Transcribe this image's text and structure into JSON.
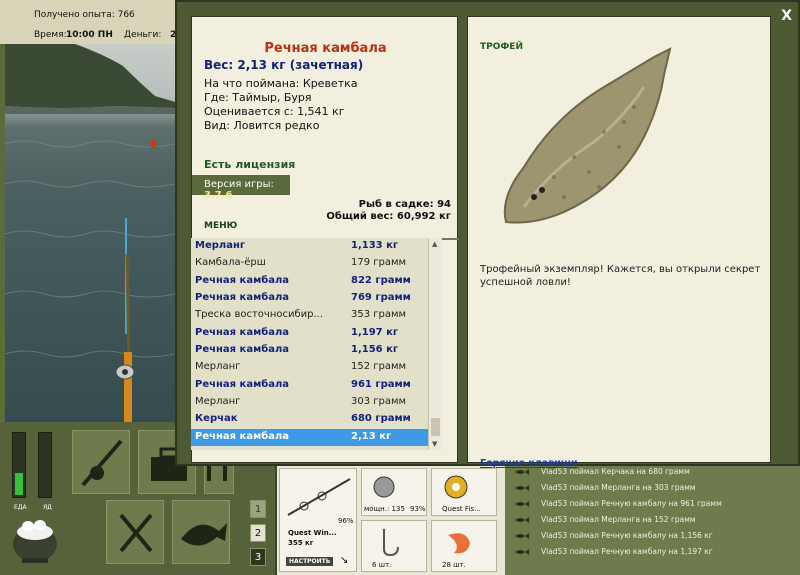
{
  "hud": {
    "xp_label": "Получено опыта: 766",
    "time_label": "Время:",
    "time_value": "10:00 ПН",
    "money_label": "Деньги:",
    "money_value": "2"
  },
  "dialog": {
    "close": "X",
    "fish_name": "Речная камбала",
    "weight": "Вес: 2,13 кг (зачетная)",
    "bait": "На что поймана: Креветка",
    "place": "Где: Таймыр, Буря",
    "value": "Оценивается с: 1,541 кг",
    "kind": "Вид: Ловится редко",
    "license": "Есть лицензия",
    "version_label": "Версия игры: ",
    "version_value": "3.7.6",
    "menu": "МЕНЮ",
    "cage_count": "Рыб в садке: 94",
    "total_weight": "Общий вес: 60,992 кг",
    "trophy_title": "ТРОФЕЙ",
    "trophy_text": "Трофейный экземпляр! Кажется, вы открыли секрет успешной ловли!",
    "hotkeys": "Горячие клавиши"
  },
  "catches": [
    {
      "name": "Мерланг",
      "weight": "1,133 кг",
      "style": "r"
    },
    {
      "name": "Камбала-ёрш",
      "weight": "179 грамм",
      "style": "c"
    },
    {
      "name": "Речная камбала",
      "weight": "822 грамм",
      "style": "r"
    },
    {
      "name": "Речная камбала",
      "weight": "769 грамм",
      "style": "r"
    },
    {
      "name": "Треска восточносибир...",
      "weight": "353 грамм",
      "style": "c"
    },
    {
      "name": "Речная камбала",
      "weight": "1,197 кг",
      "style": "r"
    },
    {
      "name": "Речная камбала",
      "weight": "1,156 кг",
      "style": "r"
    },
    {
      "name": "Мерланг",
      "weight": "152 грамм",
      "style": "c"
    },
    {
      "name": "Речная камбала",
      "weight": "961 грамм",
      "style": "r"
    },
    {
      "name": "Мерланг",
      "weight": "303 грамм",
      "style": "c"
    },
    {
      "name": "Керчак",
      "weight": "680 грамм",
      "style": "r"
    },
    {
      "name": "Речная камбала",
      "weight": "2,13 кг",
      "style": "sel"
    }
  ],
  "gauges": {
    "left_label": "ЕДА",
    "right_label": "ЯД"
  },
  "slots": {
    "s1": "1",
    "s2": "2",
    "s3": "3"
  },
  "inventory": {
    "rod_pct": "96%",
    "rod_name": "Quest Win...",
    "rod_weight": "355 кг",
    "setup": "НАСТРОИТЬ",
    "reel_power": "мощн.: 135",
    "reel_pct": "93%",
    "line_name": "Quest Fis...",
    "hooks_count": "6 шт.",
    "bait_count": "28 шт."
  },
  "log": [
    "Vlad53 поймал Керчака на 680 грамм",
    "Vlad53 поймал Мерланга на 303 грамм",
    "Vlad53 поймал Речную камбалу на 961 грамм",
    "Vlad53 поймал Мерланга на 152 грамм",
    "Vlad53 поймал Речную камбалу на 1,156 кг",
    "Vlad53 поймал Речную камбалу на 1,197 кг"
  ]
}
